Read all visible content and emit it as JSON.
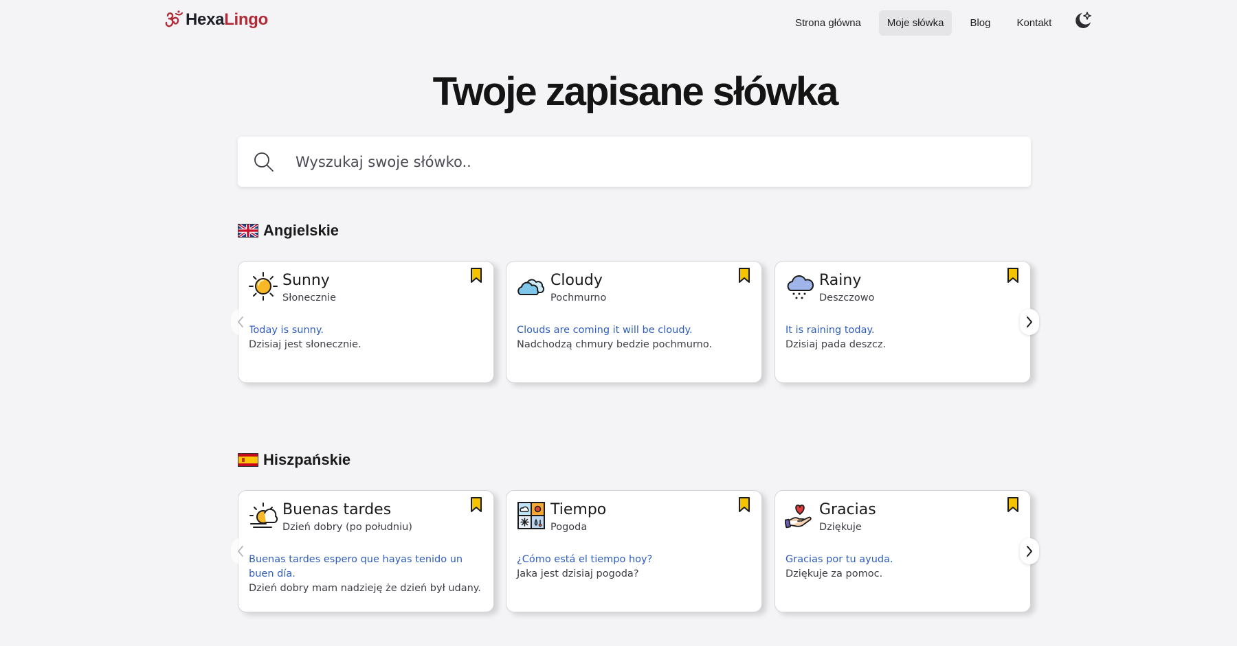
{
  "brand": {
    "name_part1": "Hexa",
    "name_part2": "Lingo",
    "logo_icon": "om-symbol-icon"
  },
  "nav": {
    "items": [
      {
        "label": "Strona główna",
        "active": false
      },
      {
        "label": "Moje słówka",
        "active": true
      },
      {
        "label": "Blog",
        "active": false
      },
      {
        "label": "Kontakt",
        "active": false
      }
    ],
    "theme_toggle_icon": "moon-star-icon"
  },
  "page": {
    "title": "Twoje zapisane słówka"
  },
  "search": {
    "placeholder": "Wyszukaj swoje słówko..",
    "value": "",
    "icon": "search-icon"
  },
  "sections": [
    {
      "title": "Angielskie",
      "flag": "uk-flag-icon",
      "cards": [
        {
          "word": "Sunny",
          "translation": "Słonecznie",
          "example": "Today is sunny.",
          "example_translation": "Dzisiaj jest słonecznie.",
          "icon": "sun-icon"
        },
        {
          "word": "Cloudy",
          "translation": "Pochmurno",
          "example": "Clouds are coming it will be cloudy.",
          "example_translation": "Nadchodzą chmury bedzie pochmurno.",
          "icon": "cloud-icon"
        },
        {
          "word": "Rainy",
          "translation": "Deszczowo",
          "example": "It is raining today.",
          "example_translation": "Dzisiaj pada deszcz.",
          "icon": "rain-cloud-icon"
        }
      ]
    },
    {
      "title": "Hiszpańskie",
      "flag": "spain-flag-icon",
      "cards": [
        {
          "word": "Buenas tardes",
          "translation": "Dzień dobry (po południu)",
          "example": "Buenas tardes espero que hayas tenido un buen día.",
          "example_translation": "Dzień dobry mam nadzieję że dzień był udany.",
          "icon": "sunset-icon"
        },
        {
          "word": "Tiempo",
          "translation": "Pogoda",
          "example": "¿Cómo está el tiempo hoy?",
          "example_translation": "Jaka jest dzisiaj pogoda?",
          "icon": "weather-grid-icon"
        },
        {
          "word": "Gracias",
          "translation": "Dziękuje",
          "example": "Gracias por tu ayuda.",
          "example_translation": "Dziękuje za pomoc.",
          "icon": "heart-hand-icon"
        }
      ]
    }
  ],
  "colors": {
    "background": "#f4f4f6",
    "brand_red": "#b02a37",
    "example_blue": "#2f5dbd",
    "bookmark_yellow": "#f5c400"
  }
}
